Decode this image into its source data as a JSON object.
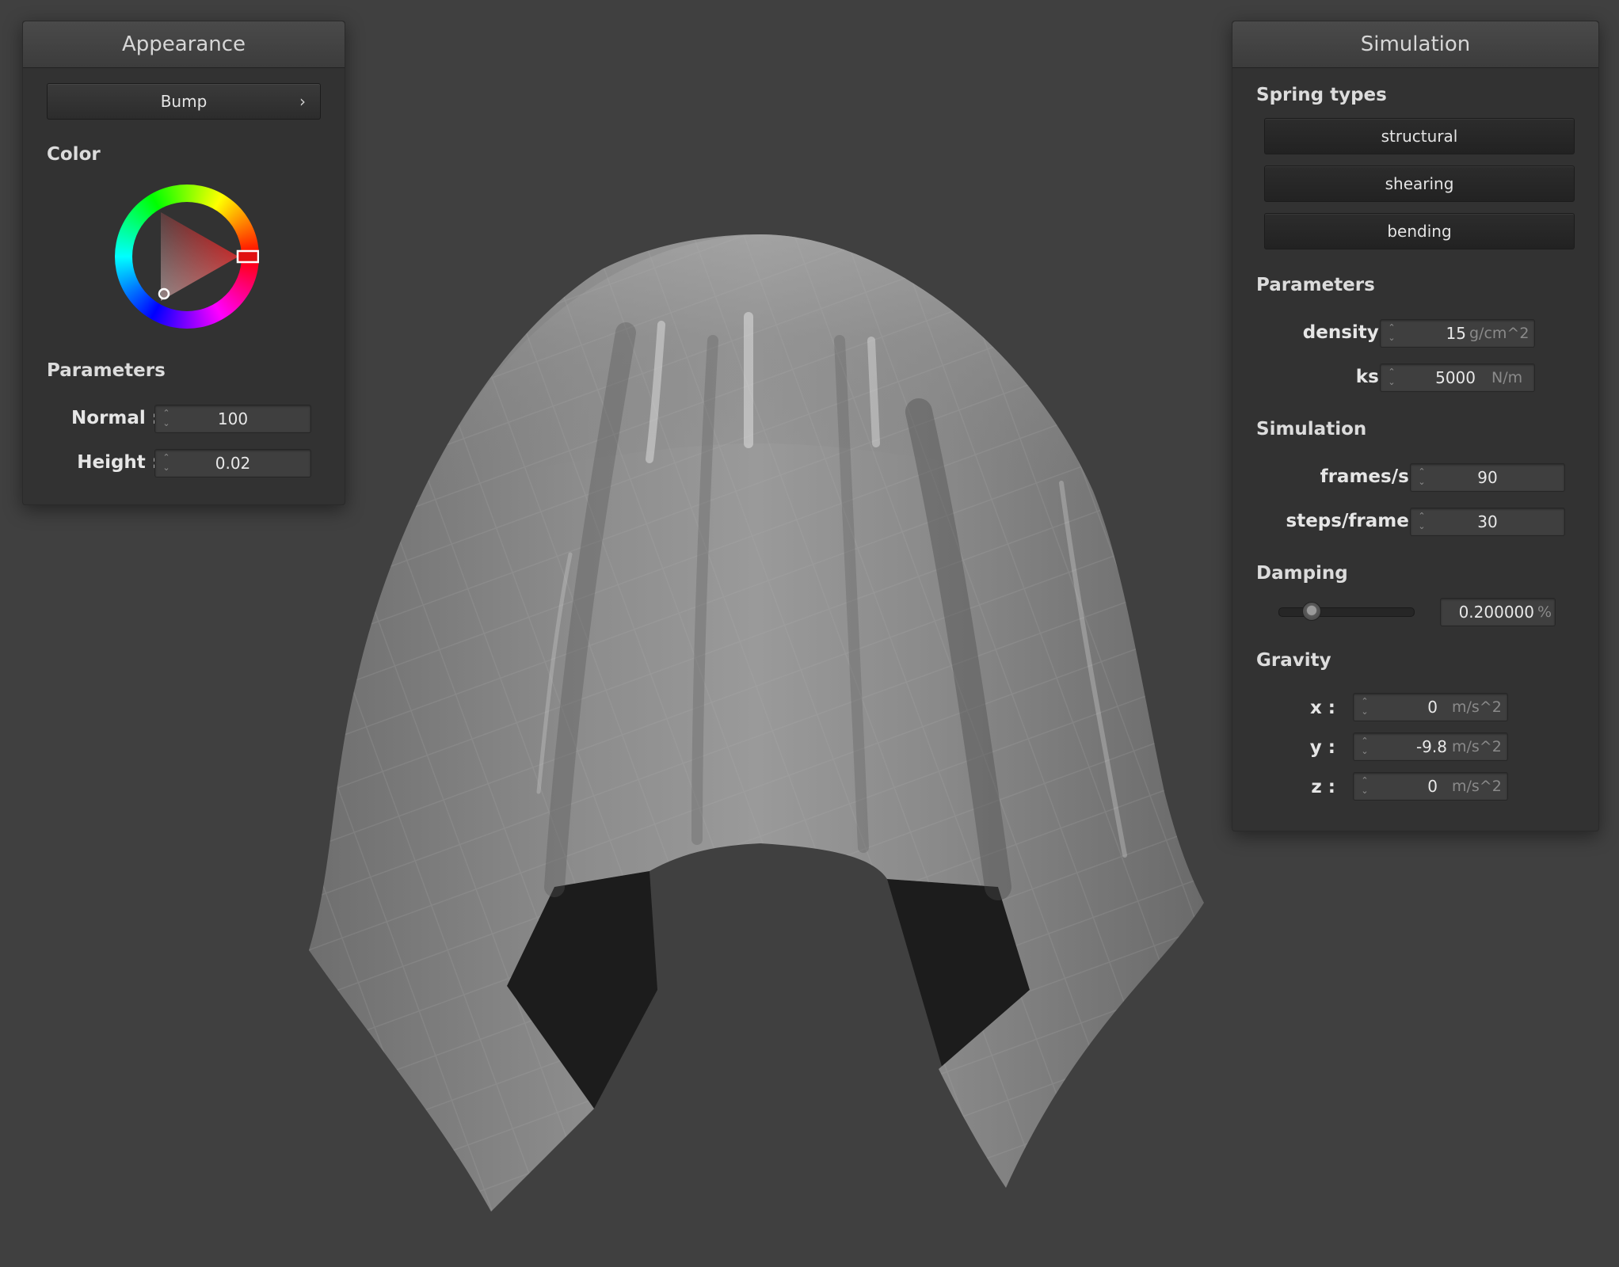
{
  "appearance": {
    "title": "Appearance",
    "mode_button": "Bump",
    "mode_chevron": "›",
    "color_label": "Color",
    "color_value": "#cc0000",
    "parameters_label": "Parameters",
    "normal": {
      "label": "Normal :",
      "value": "100"
    },
    "height": {
      "label": "Height :",
      "value": "0.02"
    }
  },
  "simulation": {
    "title": "Simulation",
    "spring_types_label": "Spring types",
    "spring_types": [
      "structural",
      "shearing",
      "bending"
    ],
    "parameters_label": "Parameters",
    "density": {
      "label": "density :",
      "value": "15",
      "unit": "g/cm^2"
    },
    "ks": {
      "label": "ks :",
      "value": "5000",
      "unit": "N/m"
    },
    "simulation_label": "Simulation",
    "frames_per_s": {
      "label": "frames/s :",
      "value": "90"
    },
    "steps_per_frame": {
      "label": "steps/frame :",
      "value": "30"
    },
    "damping_label": "Damping",
    "damping": {
      "value": "0.200000",
      "unit": "%",
      "slider_fraction": 0.2
    },
    "gravity_label": "Gravity",
    "gravity": {
      "x": {
        "label": "x :",
        "value": "0",
        "unit": "m/s^2"
      },
      "y": {
        "label": "y :",
        "value": "-9.8",
        "unit": "m/s^2"
      },
      "z": {
        "label": "z :",
        "value": "0",
        "unit": "m/s^2"
      }
    }
  },
  "colors": {
    "background": "#404040",
    "panel": "#323232",
    "cloth": "#8a8a8a"
  }
}
